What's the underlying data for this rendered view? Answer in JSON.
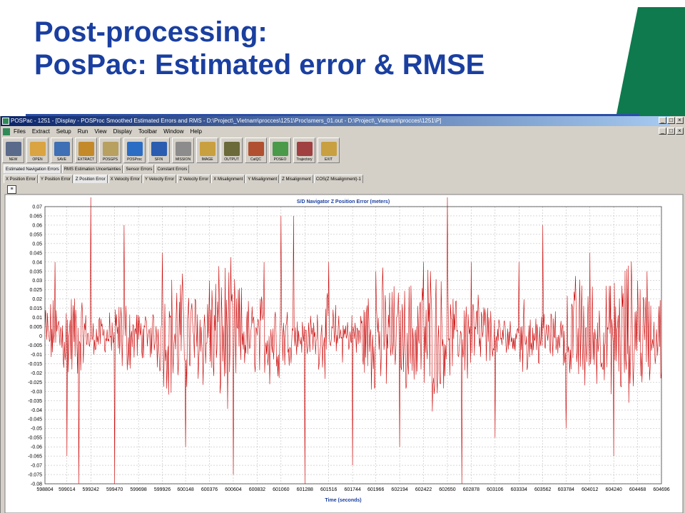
{
  "slide": {
    "title_line1": "Post-processing:",
    "title_line2": "PosPac: Estimated error & RMSE"
  },
  "colors": {
    "title": "#1a3fa0",
    "green": "#0e7a4d",
    "rule": "#2a4ea8",
    "series": "#cc0000"
  },
  "window": {
    "title": "POSPac - 1251 - [Display - POSProc Smoothed Estimated Errors and RMS - D:\\Project\\_Vietnam\\procces\\1251\\Proc\\smers_01.out - D:\\Project\\_Vietnam\\procces\\1251\\P]",
    "menu": [
      "Files",
      "Extract",
      "Setup",
      "Run",
      "View",
      "Display",
      "Toolbar",
      "Window",
      "Help"
    ],
    "toolbar": [
      {
        "label": "NEW",
        "icon": "monitor-icon",
        "color": "#5a6a8a"
      },
      {
        "label": "OPEN",
        "icon": "open-folder-icon",
        "color": "#d9a441"
      },
      {
        "label": "SAVE",
        "icon": "save-icon",
        "color": "#3f6fb5"
      },
      {
        "label": "EXTRACT",
        "icon": "extract-icon",
        "color": "#c48a2a"
      },
      {
        "label": "POSGPS",
        "icon": "satellite-icon",
        "color": "#b8a060"
      },
      {
        "label": "POSProc",
        "icon": "globe-icon",
        "color": "#2b6cc4"
      },
      {
        "label": "SFIN",
        "icon": "network-icon",
        "color": "#2b5cb0"
      },
      {
        "label": "MISSION",
        "icon": "mission-icon",
        "color": "#8c8c8c"
      },
      {
        "label": "IMAGE",
        "icon": "camera-icon",
        "color": "#c9a040"
      },
      {
        "label": "OUTPUT",
        "icon": "grid-icon",
        "color": "#6a6a3a"
      },
      {
        "label": "CalQC",
        "icon": "calqc-icon",
        "color": "#b05030"
      },
      {
        "label": "POSEO",
        "icon": "poseo-icon",
        "color": "#4a9a4a"
      },
      {
        "label": "Trajectory",
        "icon": "trajectory-icon",
        "color": "#a04040"
      },
      {
        "label": "EXIT",
        "icon": "exit-icon",
        "color": "#c8a040"
      }
    ],
    "tabs_top": [
      "Estimated Navigation Errors",
      "RMS Estimation Uncertainties",
      "Sensor Errors",
      "Constant Errors"
    ],
    "tabs_bottom": [
      "X Position Error",
      "Y Position Error",
      "Z Position Error",
      "X Velocity Error",
      "Y Velocity Error",
      "Z Velocity Error",
      "X Misalignment",
      "Y Misalignment",
      "Z Misalignment",
      "COS(Z Misalignment)-1"
    ],
    "active_tab_index": 2
  },
  "chart_data": {
    "type": "line",
    "title": "S/D Navigator Z Position Error (meters)",
    "xlabel": "Time (seconds)",
    "ylabel": "",
    "xlim": [
      598804,
      604696
    ],
    "ylim": [
      -0.08,
      0.07
    ],
    "yticks": [
      0.07,
      0.065,
      0.06,
      0.055,
      0.05,
      0.045,
      0.04,
      0.035,
      0.03,
      0.025,
      0.02,
      0.015,
      0.01,
      0.005,
      0,
      -0.005,
      -0.01,
      -0.015,
      -0.02,
      -0.025,
      -0.03,
      -0.035,
      -0.04,
      -0.045,
      -0.05,
      -0.055,
      -0.06,
      -0.065,
      -0.07,
      -0.075,
      -0.08
    ],
    "xticks": [
      598804,
      599014,
      599242,
      599470,
      599698,
      599926,
      600148,
      600376,
      600604,
      600832,
      601060,
      601288,
      601516,
      601744,
      601966,
      602194,
      602422,
      602650,
      602878,
      603106,
      603334,
      603562,
      603784,
      604012,
      604240,
      604468,
      604696
    ],
    "grid": true,
    "series": [
      {
        "color": "#cc0000",
        "x_step": 6,
        "values_note_removed": true,
        "peaks": [
          [
            599242,
            0.075
          ],
          [
            599014,
            -0.065
          ],
          [
            598900,
            0.04
          ],
          [
            599130,
            -0.08
          ],
          [
            599470,
            -0.08
          ],
          [
            599560,
            0.06
          ],
          [
            599926,
            0.045
          ],
          [
            600148,
            -0.06
          ],
          [
            600376,
            0.03
          ],
          [
            600604,
            -0.075
          ],
          [
            600900,
            0.04
          ],
          [
            601060,
            0.065
          ],
          [
            601180,
            0.065
          ],
          [
            601288,
            -0.08
          ],
          [
            601516,
            0.04
          ],
          [
            601744,
            -0.07
          ],
          [
            601966,
            0.035
          ],
          [
            602194,
            -0.06
          ],
          [
            602422,
            0.04
          ],
          [
            602650,
            0.075
          ],
          [
            602790,
            -0.08
          ],
          [
            602878,
            0.04
          ],
          [
            603106,
            -0.055
          ],
          [
            603334,
            0.04
          ],
          [
            603562,
            0.06
          ],
          [
            603784,
            -0.05
          ],
          [
            604012,
            0.045
          ],
          [
            604240,
            -0.065
          ],
          [
            604468,
            0.03
          ],
          [
            604560,
            0.035
          ],
          [
            604696,
            -0.02
          ]
        ]
      }
    ]
  }
}
